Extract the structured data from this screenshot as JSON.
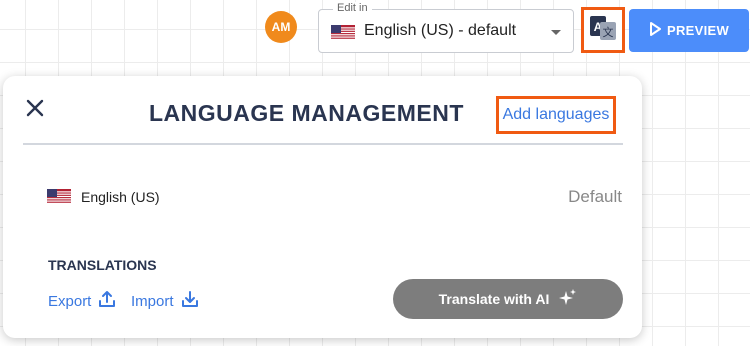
{
  "header": {
    "avatar_initials": "AM",
    "edit_in_label": "Edit in",
    "edit_in_value": "English (US) - default",
    "preview_label": "PREVIEW",
    "accent": "#4c8dfa",
    "highlight": "#f05a12",
    "icons": {
      "flag": "us-flag-icon",
      "caret": "chevron-down-icon",
      "translate": "translate-icon",
      "play": "play-icon"
    }
  },
  "panel": {
    "title": "LANGUAGE MANAGEMENT",
    "add_languages": "Add languages",
    "languages": [
      {
        "name": "English (US)",
        "status": "Default"
      }
    ],
    "translations_heading": "TRANSLATIONS",
    "export_label": "Export",
    "import_label": "Import",
    "translate_ai_label": "Translate with AI",
    "icons": {
      "close": "close-icon",
      "export": "export-icon",
      "import": "import-icon",
      "ai": "sparkle-icon"
    }
  }
}
